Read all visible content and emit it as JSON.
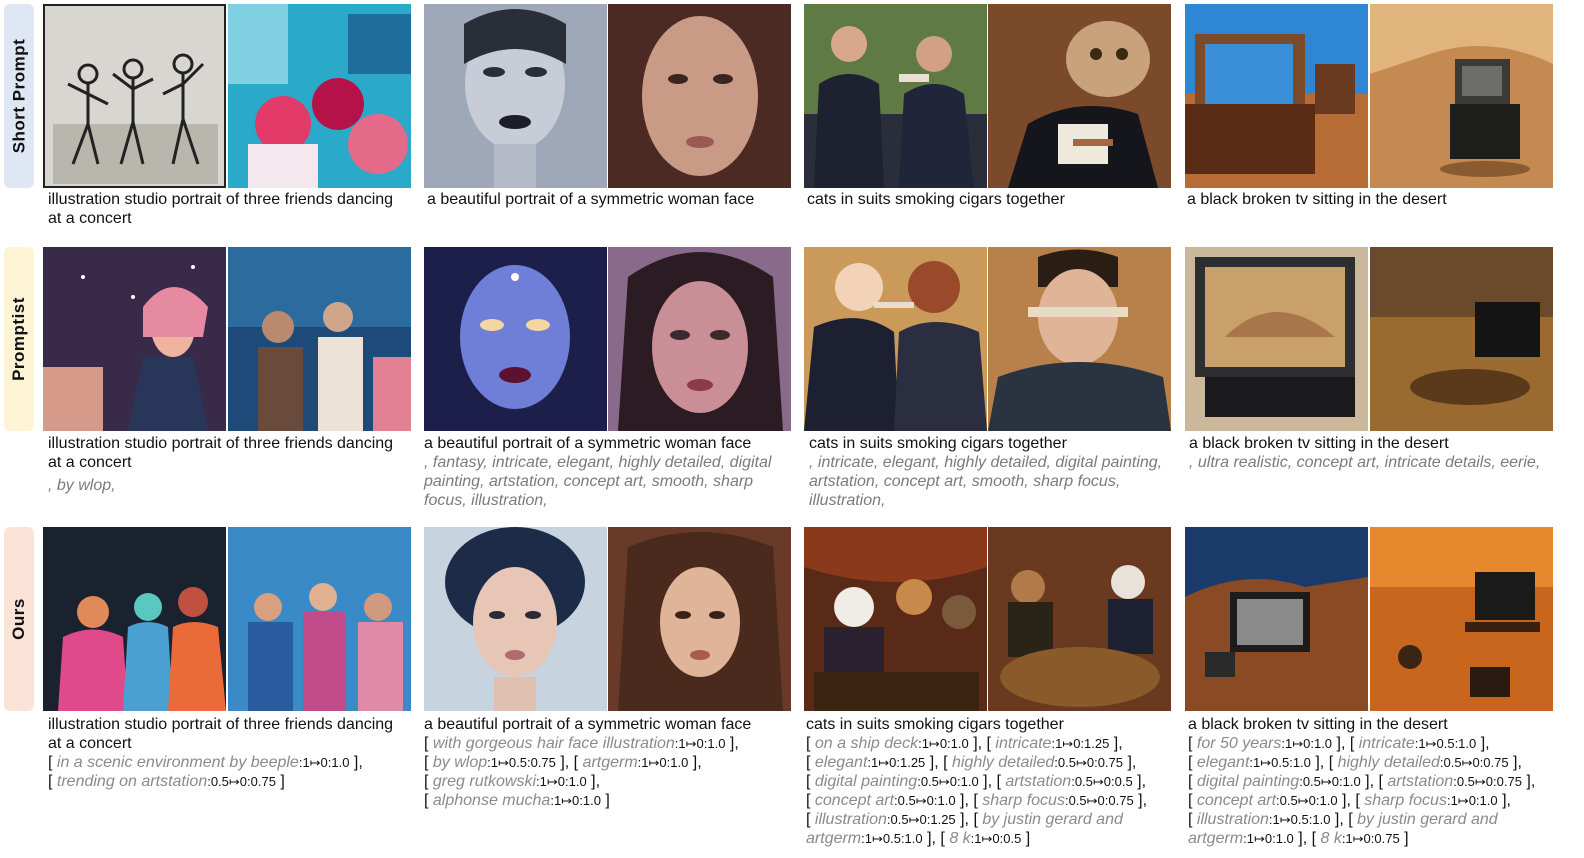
{
  "rows": [
    {
      "label": "Short Prompt",
      "color": "#dfe7f5"
    },
    {
      "label": "Promptist",
      "color": "#fdf3d5"
    },
    {
      "label": "Ours",
      "color": "#fbe3d8"
    }
  ],
  "captions": {
    "short": [
      "illustration studio portrait of three friends dancing at a concert",
      "a beautiful portrait of a symmetric woman face",
      "cats in suits smoking cigars together",
      "a black broken tv sitting in the desert"
    ],
    "promptist_extra": [
      ", by wlop,",
      ", fantasy, intricate, elegant, highly detailed, digital painting, artstation, concept art, smooth, sharp focus, illustration,",
      ", intricate, elegant, highly detailed, digital painting, artstation, concept art, smooth, sharp focus, illustration,",
      ", ultra realistic, concept art, intricate details, eerie,"
    ]
  },
  "ours_weights": [
    [
      {
        "t": "in a scenic environment by beeple",
        "n": "1↦0:1.0"
      },
      {
        "t": "trending on artstation",
        "n": "0.5↦0:0.75"
      }
    ],
    [
      {
        "t": "with gorgeous hair face illustration",
        "n": "1↦0:1.0"
      },
      {
        "t": "by wlop",
        "n": "1↦0.5:0.75"
      },
      {
        "t": "artgerm",
        "n": "1↦0:1.0"
      },
      {
        "t": "greg rutkowski",
        "n": "1↦0:1.0"
      },
      {
        "t": "alphonse mucha",
        "n": "1↦0:1.0"
      }
    ],
    [
      {
        "t": "on a ship deck",
        "n": "1↦0:1.0"
      },
      {
        "t": "intricate",
        "n": "1↦0:1.25"
      },
      {
        "t": "elegant",
        "n": "1↦0:1.25"
      },
      {
        "t": "highly detailed",
        "n": "0.5↦0:0.75"
      },
      {
        "t": "digital painting",
        "n": "0.5↦0:1.0"
      },
      {
        "t": "artstation",
        "n": "0.5↦0:0.5"
      },
      {
        "t": "concept art",
        "n": "0.5↦0:1.0"
      },
      {
        "t": "sharp focus",
        "n": "0.5↦0:0.75"
      },
      {
        "t": "illustration",
        "n": "0.5↦0:1.25"
      },
      {
        "t": "by justin gerard and artgerm",
        "n": "1↦0.5:1.0"
      },
      {
        "t": "8 k",
        "n": "1↦0:0.5"
      }
    ],
    [
      {
        "t": "for 50 years",
        "n": "1↦0:1.0"
      },
      {
        "t": "intricate",
        "n": "1↦0.5:1.0"
      },
      {
        "t": "elegant",
        "n": "1↦0.5:1.0"
      },
      {
        "t": "highly detailed",
        "n": "0.5↦0:0.75"
      },
      {
        "t": "digital painting",
        "n": "0.5↦0:1.0"
      },
      {
        "t": "artstation",
        "n": "0.5↦0:0.75"
      },
      {
        "t": "concept art",
        "n": "0.5↦0:1.0"
      },
      {
        "t": "sharp focus",
        "n": "1↦0:1.0"
      },
      {
        "t": "illustration",
        "n": "1↦0.5:1.0"
      },
      {
        "t": "by justin gerard and artgerm",
        "n": "1↦0:1.0"
      },
      {
        "t": "8 k",
        "n": "1↦0:0.75"
      }
    ]
  ]
}
